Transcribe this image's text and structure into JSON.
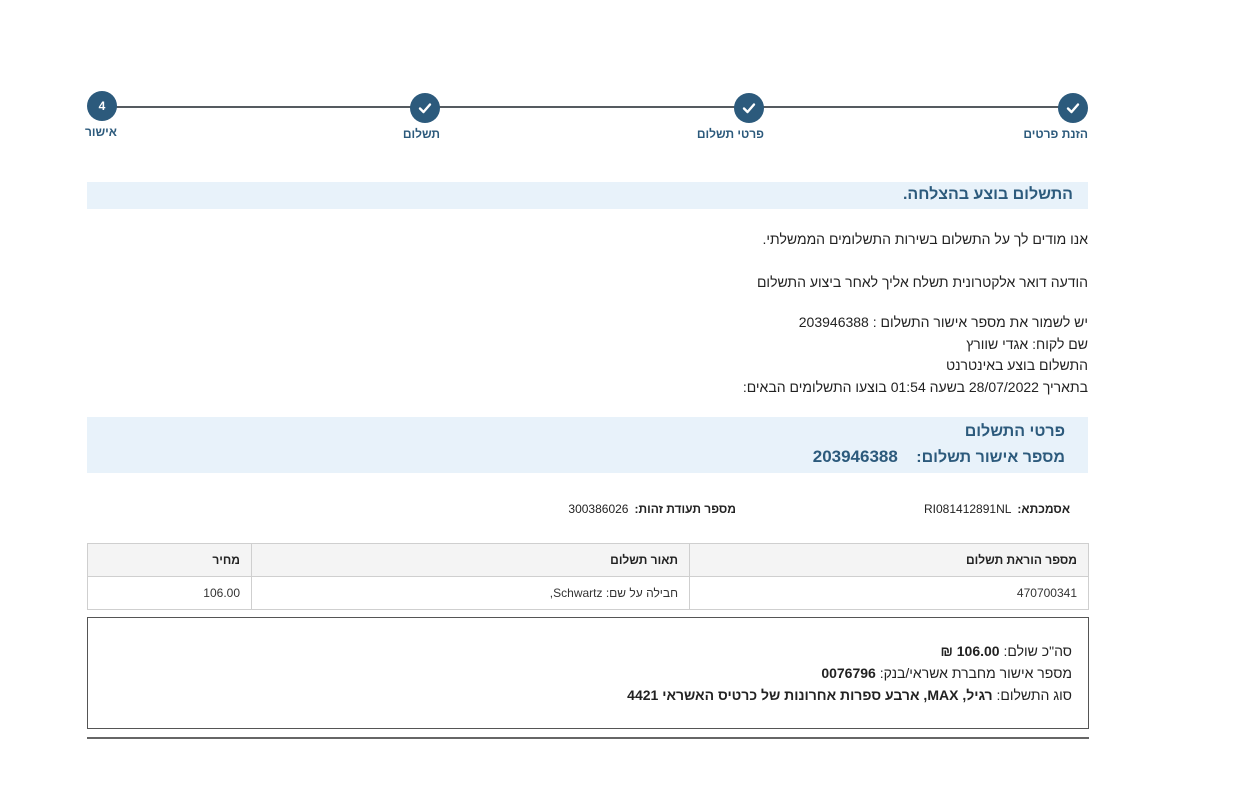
{
  "stepper": {
    "steps": [
      {
        "label": "הזנת פרטים",
        "state": "done",
        "icon": "check-icon"
      },
      {
        "label": "פרטי תשלום",
        "state": "done",
        "icon": "check-icon"
      },
      {
        "label": "תשלום",
        "state": "done",
        "icon": "check-icon"
      },
      {
        "label": "אישור",
        "state": "current",
        "number": "4"
      }
    ]
  },
  "success": {
    "title": "התשלום בוצע בהצלחה.",
    "lines": [
      "אנו מודים לך על התשלום בשירות התשלומים הממשלתי.",
      "הודעה דואר אלקטרונית תשלח אליך לאחר ביצוע התשלום",
      "יש לשמור את מספר אישור התשלום : 203946388",
      "שם לקוח: אגדי שוורץ",
      "התשלום בוצע באינטרנט",
      "בתאריך 28/07/2022 בשעה 01:54 בוצעו התשלומים הבאים:"
    ]
  },
  "details": {
    "title": "פרטי התשלום",
    "approval_label": "מספר אישור תשלום:",
    "approval_number": "203946388",
    "reference_label": "אסמכתא:",
    "reference_value": "RI081412891NL",
    "id_label": "מספר תעודת זהות:",
    "id_value": "300386026"
  },
  "table": {
    "headers": [
      "מספר הוראת תשלום",
      "תאור תשלום",
      "מחיר"
    ],
    "rows": [
      [
        "470700341",
        "חבילה על שם: Schwartz,",
        "106.00"
      ]
    ]
  },
  "summary": {
    "total_label": "סה\"כ שולם:",
    "total_value": "106.00 ₪",
    "bank_label": "מספר אישור מחברת אשראי/בנק:",
    "bank_value": "0076796",
    "type_label": "סוג התשלום:",
    "type_value": "רגיל, MAX, ארבע ספרות אחרונות של כרטיס האשראי 4421"
  },
  "colors": {
    "accent": "#2c5a7c",
    "band": "#e8f2fa"
  }
}
